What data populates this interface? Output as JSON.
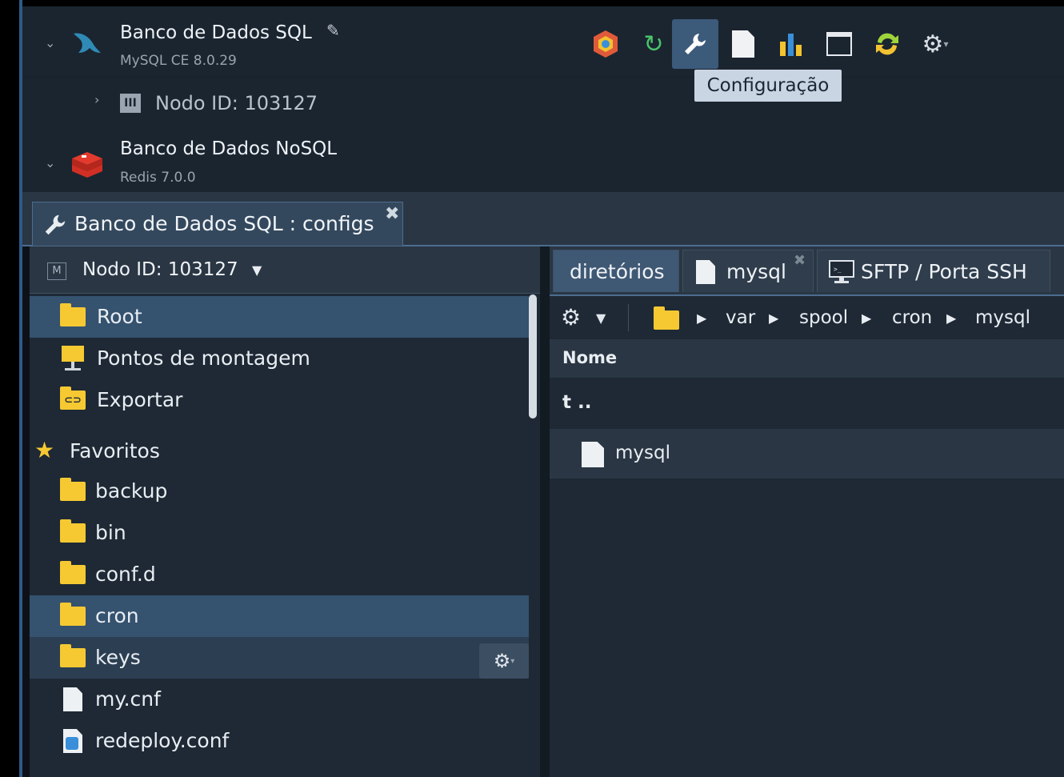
{
  "environment": {
    "nodes": [
      {
        "title": "Banco de Dados SQL",
        "subtitle": "MySQL CE 8.0.29"
      },
      {
        "title": "Banco de Dados NoSQL",
        "subtitle": "Redis 7.0.0"
      }
    ],
    "node_item": "Nodo ID: 103127",
    "toolbar": {
      "icons": [
        "addons-icon",
        "restart-icon",
        "config-icon",
        "log-icon",
        "statistics-icon",
        "web-ssh-icon",
        "redeploy-icon",
        "settings-icon"
      ],
      "tooltip": "Configuração"
    }
  },
  "editor": {
    "tab_label": "Banco de Dados SQL : configs",
    "node_selector": "Nodo ID: 103127",
    "node_badge": "M",
    "tree": {
      "root_items": [
        "Root",
        "Pontos de montagem",
        "Exportar"
      ],
      "favorites_label": "Favoritos",
      "favorites": [
        "backup",
        "bin",
        "conf.d",
        "cron",
        "keys",
        "my.cnf",
        "redeploy.conf"
      ]
    },
    "right_tabs": [
      "diretórios",
      "mysql",
      "SFTP / Porta SSH"
    ],
    "breadcrumb": [
      "var",
      "spool",
      "cron",
      "mysql"
    ],
    "table": {
      "column": "Nome",
      "parent_row": "t ..",
      "rows": [
        "mysql"
      ]
    }
  },
  "colors": {
    "accent": "#3c5a7a",
    "folder": "#f6c932",
    "panel": "#1e2935",
    "tooltip_bg": "#c9d5e3"
  }
}
